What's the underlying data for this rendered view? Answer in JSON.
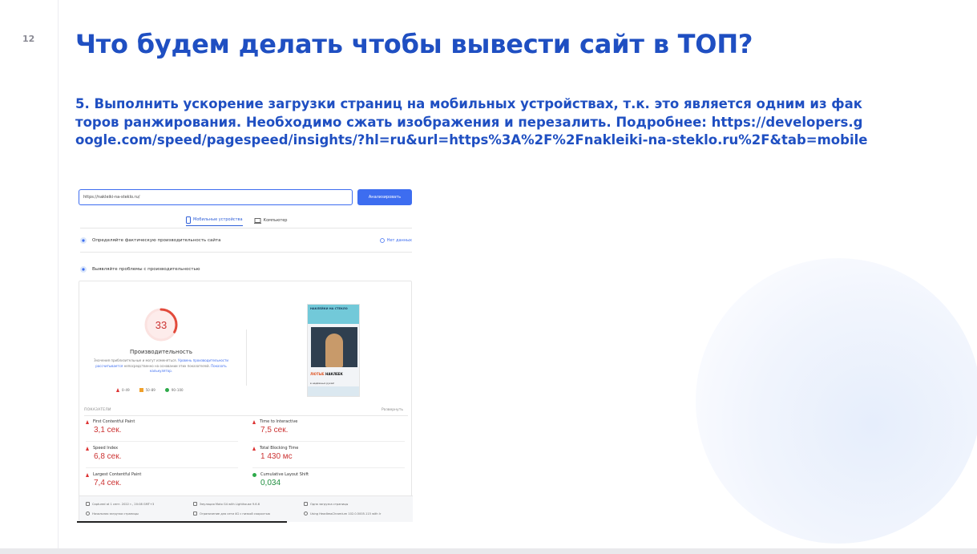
{
  "slide": {
    "page_number": "12",
    "title": "Что будем делать чтобы вывести сайт в ТОП?",
    "body": "5. Выполнить ускорение загрузки страниц на мобильных устройствах, т.к. это является одним из факторов ранжирования. Необходимо сжать изображения и перезалить. Подробнее: https://developers.google.com/speed/pagespeed/insights/?hl=ru&url=https%3A%2F%2Fnakleiki-na-steklo.ru%2F&tab=mobile"
  },
  "pagespeed": {
    "url_value": "https://nakleiki-na-steklo.ru/",
    "analyze_label": "Анализировать",
    "tabs": [
      {
        "label": "Мобильные устройства",
        "icon": "phone-icon",
        "active": true
      },
      {
        "label": "Компьютер",
        "icon": "laptop-icon",
        "active": false
      }
    ],
    "field_data": {
      "label": "Определяйте фактическую производительность сайта",
      "status": "Нет данных"
    },
    "lab_data": {
      "label": "Выявляйте проблемы с производительностью"
    },
    "score": 33,
    "score_label": "Производительность",
    "score_desc_1": "Значения приблизительные и могут изменяться.",
    "score_desc_link_1": "Уровень производительности рассчитывается",
    "score_desc_2": "непосредственно на основании этих показателей.",
    "score_desc_link_2": "Показать калькулятор.",
    "legend": [
      {
        "range": "0–49",
        "color": "#d33"
      },
      {
        "range": "50–89",
        "color": "#f0a12c"
      },
      {
        "range": "90–100",
        "color": "#2eaa4a"
      }
    ],
    "thumbnail": {
      "brand": "НАКЛЕЙКИ НА СТЕКЛО",
      "line1_hl": "ЛЮТЫЕ",
      "line1": "НАКЛЕЕК",
      "line2": "в надёжных руках!"
    },
    "metrics_header": "ПОКАЗАТЕЛИ",
    "expand_label": "Развернуть",
    "metrics": [
      {
        "name": "First Contentful Paint",
        "value": "3,1 сек.",
        "status": "bad"
      },
      {
        "name": "Time to Interactive",
        "value": "7,5 сек.",
        "status": "bad"
      },
      {
        "name": "Speed Index",
        "value": "6,8 сек.",
        "status": "bad"
      },
      {
        "name": "Total Blocking Time",
        "value": "1 430 мс",
        "status": "bad"
      },
      {
        "name": "Largest Contentful Paint",
        "value": "7,4 сек.",
        "status": "bad"
      },
      {
        "name": "Cumulative Layout Shift",
        "value": "0,034",
        "status": "good"
      }
    ],
    "footer": {
      "captured": "Captured at 1 сент. 2022 г., 20:08 GMT+3",
      "initial_load": "Начальная загрузка страницы",
      "emulation": "Эмуляция Moto G4 with Lighthouse 9.6.6",
      "throttling": "Ограничение для сети 4G с низкой скоростью",
      "single_load": "Одна загрузка страницы",
      "browser": "Using HeadlessChromium 102.0.5005.115 with lr"
    }
  }
}
